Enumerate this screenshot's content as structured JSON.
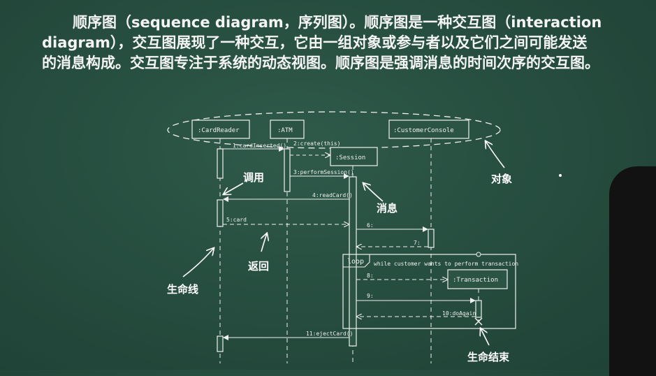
{
  "paragraph": {
    "line1": "顺序图（sequence diagram，序列图）。顺序图是一种交互图（interaction",
    "line2": "diagram），交互图展现了一种交互，它由一组对象或参与者以及它们之间可能发送",
    "line3": "的消息构成。交互图专注于系统的动态视图。顺序图是强调消息的时间次序的交互图。"
  },
  "objects": {
    "card_reader": ":CardReader",
    "atm": ":ATM",
    "customer_console": ":CustomerConsole",
    "session": ":Session",
    "transaction": ":Transaction"
  },
  "messages": {
    "m1": "1:cardInserted()",
    "m2": "2:create(this)",
    "m3": "3:performSession()",
    "m4": "4:readCard()",
    "m5": "5:card",
    "m6": "6:",
    "m7": "7:",
    "m8": "8:",
    "m9": "9:",
    "m10": "10:doAgain",
    "m11": "11:ejectCard()"
  },
  "loop": {
    "tag": "loop",
    "guard": "while customer wants to perform transaction"
  },
  "annotations": {
    "objects": "对象",
    "call": "调用",
    "message": "消息",
    "return": "返回",
    "lifeline": "生命线",
    "lifeline_end": "生命结束"
  }
}
